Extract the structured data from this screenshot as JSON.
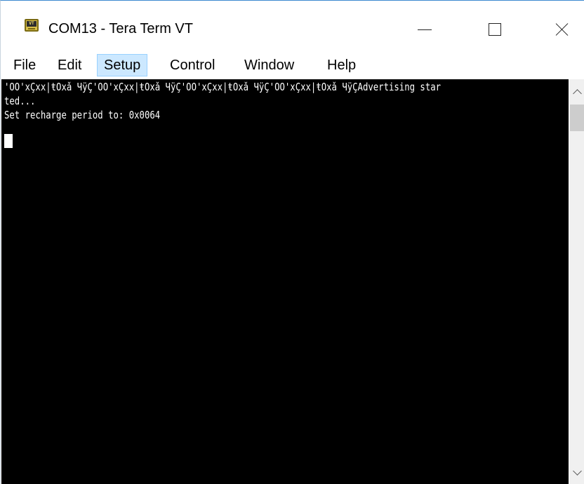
{
  "window": {
    "title": "COM13 - Tera Term VT",
    "icon_text": "VT",
    "icon": "tera-term-icon"
  },
  "caption_buttons": {
    "minimize": "minimize-icon",
    "maximize": "maximize-icon",
    "close": "close-icon"
  },
  "menu": {
    "items": [
      {
        "label": "File"
      },
      {
        "label": "Edit"
      },
      {
        "label": "Setup"
      },
      {
        "label": "Control"
      },
      {
        "label": "Window"
      },
      {
        "label": "Help"
      }
    ],
    "active_item": "Setup"
  },
  "terminal": {
    "lines": [
      "'OO'xÇxx|ŧOxǎ ЧÿÇ'OO'xÇxx|ŧOxǎ ЧÿÇ'OO'xÇxx|ŧOxǎ ЧÿÇ'OO'xÇxx|ŧOxǎ ЧÿÇAdvertising star",
      "ted...",
      "Set recharge period to: 0x0064"
    ],
    "background_color": "#000000",
    "text_color": "#ffffff"
  },
  "colors": {
    "menu_highlight": "#cce8ff",
    "window_border": "#3c89d0"
  }
}
